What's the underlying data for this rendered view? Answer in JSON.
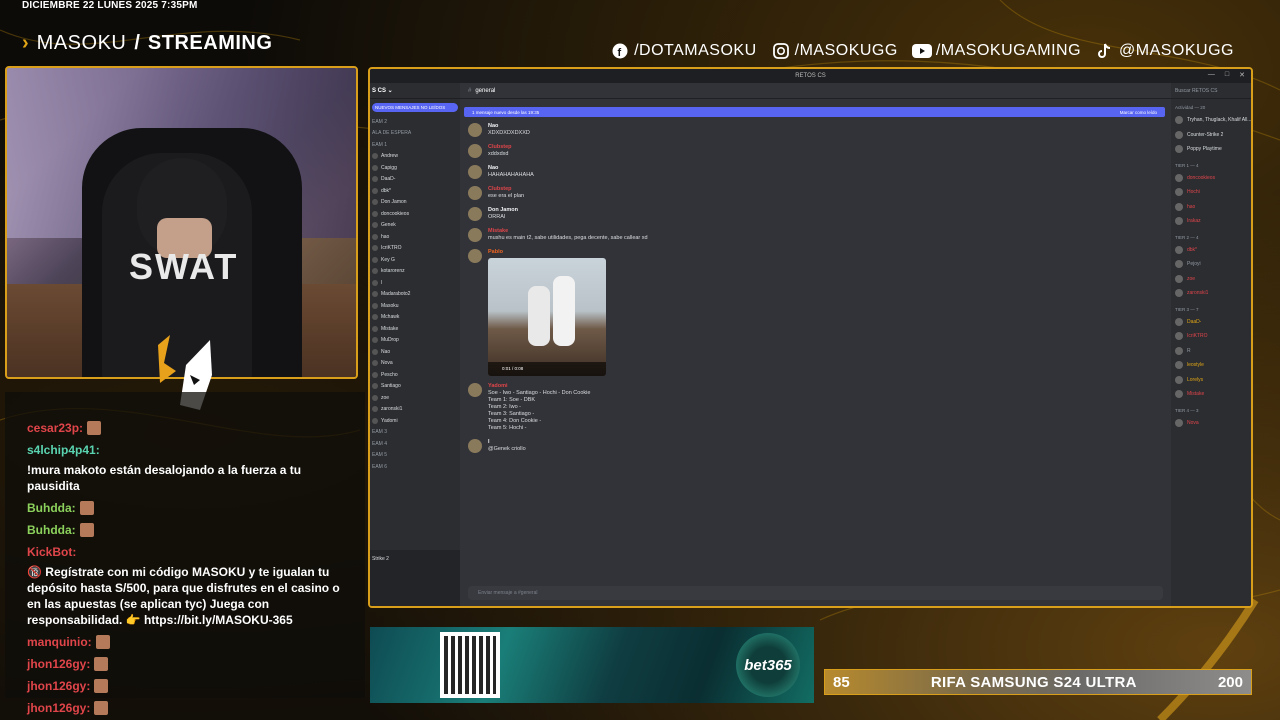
{
  "overlay": {
    "date": "DICIEMBRE 22 LUNES 2025 7:35PM",
    "brand_main": "MASOKU",
    "brand_sep": "/",
    "brand_sub": "STREAMING",
    "socials": [
      {
        "icon": "facebook-icon",
        "label": "/DOTAMASOKU"
      },
      {
        "icon": "instagram-icon",
        "label": "/MASOKUGG"
      },
      {
        "icon": "youtube-icon",
        "label": "/MASOKUGAMING"
      },
      {
        "icon": "tiktok-icon",
        "label": "@MASOKUGG"
      }
    ],
    "accent": "#d99f1a"
  },
  "webcam": {
    "shirt_text": "SWAT"
  },
  "chat": [
    {
      "user": "cesar23p:",
      "color": "#e0454a",
      "text": "",
      "emote": true
    },
    {
      "user": "s4lchip4p41:",
      "color": "#5ad4b0",
      "text": "!mura makoto están desalojando a la fuerza a tu pausidita"
    },
    {
      "user": "Buhdda:",
      "color": "#8bd15b",
      "text": "",
      "emote": true
    },
    {
      "user": "Buhdda:",
      "color": "#8bd15b",
      "text": "",
      "emote": true
    },
    {
      "user": "KickBot:",
      "color": "#e0454a",
      "text": "🔞 Regístrate con mi código MASOKU y te igualan tu depósito hasta S/500, para que disfrutes en el casino o en las apuestas (se aplican tyc) Juega con responsabilidad. 👉 https://bit.ly/MASOKU-365"
    },
    {
      "user": "manquinio:",
      "color": "#e0454a",
      "text": "",
      "emote": true
    },
    {
      "user": "jhon126gy:",
      "color": "#e0454a",
      "text": "",
      "emote": true
    },
    {
      "user": "jhon126gy:",
      "color": "#e0454a",
      "text": "",
      "emote": true
    },
    {
      "user": "jhon126gy:",
      "color": "#e0454a",
      "text": "",
      "emote": true
    }
  ],
  "discord": {
    "window_title": "RETOS CS",
    "server_name": "S CS",
    "unread_label": "NUEVOS MENSAJES NO LEÍDOS",
    "channel": "general",
    "new_messages_bar": "1 mensaje nuevo desde las 19:35",
    "mark_read": "Marcar como leído",
    "input_placeholder": "Enviar mensaje a #general",
    "members_search": "Buscar RETOS CS",
    "sidebar_rows": [
      "EAM 2",
      "ALA DE ESPERA",
      "EAM 1",
      "Andrew",
      "Capigg",
      "DaaD-",
      "dbk*",
      "Don Jamon",
      "doncookieos",
      "Genek",
      "hao",
      "IcriKTRO",
      "Key G",
      "kotarorenz",
      "l",
      "Madaraboto2",
      "Masoku",
      "Mchawk",
      "Mistake",
      "MuDrop",
      "Nao",
      "Nova",
      "Pescho",
      "Santiago",
      "zoe",
      "zaronski1",
      "Yadomi",
      "EAM 3",
      "EAM 4",
      "EAM 5",
      "EAM 6"
    ],
    "sidebar_bottom": "Strike 2",
    "messages": [
      {
        "name": "Nao",
        "color": "#f2f3f5",
        "text": "XDXDXDXDXXD"
      },
      {
        "name": "Clubstep",
        "color": "#e0454a",
        "text": "xddxdxd"
      },
      {
        "name": "Nao",
        "color": "#f2f3f5",
        "text": "HAHAHAHAHAHA"
      },
      {
        "name": "Clubstep",
        "color": "#e0454a",
        "text": "ese era el plan"
      },
      {
        "name": "Don Jamon",
        "color": "#f2f3f5",
        "text": "ORRAI"
      },
      {
        "name": "Mistake",
        "color": "#e0454a",
        "text": "mushu es main t2, sabe utilidades, pega decente, sabe callear xd"
      },
      {
        "name": "Pablo",
        "color": "#f26522",
        "text": "",
        "photo": true,
        "video_time": "0:01 / 0:08"
      },
      {
        "name": "Yadomi",
        "color": "#e0454a",
        "text": "Soe - Iwo - Santiago - Hochi - Don Cookie\nTeam 1: Soe - DBK\nTeam 2: Iwo -\nTeam 3: Santiago -\nTeam 4: Don Cookie -\nTeam 5: Hochi -"
      },
      {
        "name": "l",
        "color": "#f2f3f5",
        "text": "@Genek criollo"
      }
    ],
    "member_categories": [
      "Actividad — 20",
      "TIER 1 — 4",
      "TIER 2 — 4",
      "TIER 3 — 7",
      "TIER 4 — 3",
      "TIER 5 — 5"
    ],
    "members": [
      {
        "name": "Tryhan, Thuglack, Khalif All...",
        "color": "#dbdee1"
      },
      {
        "name": "Counter-Strike 2",
        "color": "#dbdee1"
      },
      {
        "name": "Poppy Playtime",
        "color": "#dbdee1"
      },
      {
        "name": "doncookieos",
        "color": "#e0454a"
      },
      {
        "name": "Hochi",
        "color": "#e0454a"
      },
      {
        "name": "hao",
        "color": "#e0454a"
      },
      {
        "name": "Irakaz",
        "color": "#e0454a"
      },
      {
        "name": "dbk*",
        "color": "#e0454a"
      },
      {
        "name": "Pejoyi",
        "color": "#949ba4"
      },
      {
        "name": "zoe",
        "color": "#e0454a"
      },
      {
        "name": "zaronski1",
        "color": "#e0454a"
      },
      {
        "name": "DaaD-",
        "color": "#e0a516"
      },
      {
        "name": "IcriKTRO",
        "color": "#e0454a"
      },
      {
        "name": "R",
        "color": "#949ba4"
      },
      {
        "name": "leostyle",
        "color": "#e0a516"
      },
      {
        "name": "Lorelys",
        "color": "#e0a516"
      },
      {
        "name": "Mistake",
        "color": "#e0454a"
      },
      {
        "name": "Nova",
        "color": "#e0454a"
      }
    ]
  },
  "banner": {
    "brand": "bet365"
  },
  "raffle": {
    "left": "85",
    "title": "RIFA SAMSUNG S24 ULTRA",
    "right": "200"
  }
}
